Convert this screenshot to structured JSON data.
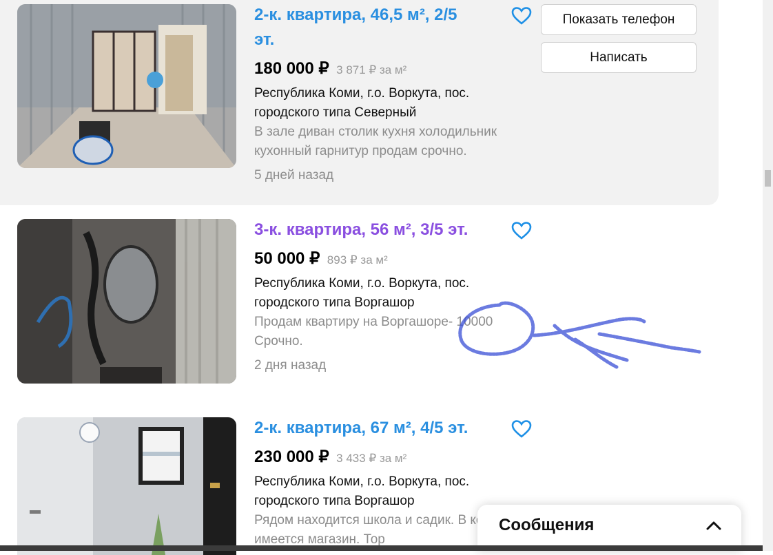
{
  "listings": [
    {
      "title": "2-к. квартира, 46,5 м², 2/5 эт.",
      "price": "180 000 ₽",
      "price_per_m2": "3 871 ₽ за м²",
      "address": "Республика Коми, г.о. Воркута, пос. городского типа Северный",
      "description": "В зале диван столик кухня холодильник кухонный гарнитур продам срочно.",
      "date": "5 дней назад",
      "actions": {
        "phone": "Показать телефон",
        "write": "Написать"
      }
    },
    {
      "title": "3-к. квартира, 56 м², 3/5 эт.",
      "price": "50 000 ₽",
      "price_per_m2": "893 ₽ за м²",
      "address": "Республика Коми, г.о. Воркута, пос. городского типа Воргашор",
      "description": "Продам квартиру на Воргашоре- 10000 Срочно.",
      "date": "2 дня назад"
    },
    {
      "title": "2-к. квартира, 67 м², 4/5 эт.",
      "price": "230 000 ₽",
      "price_per_m2": "3 433 ₽ за м²",
      "address": "Республика Коми, г.о. Воркута, пос. городского типа Воргашор",
      "description": "Рядом находится школа и садик. В конце дома имеется магазин. Тор"
    }
  ],
  "messages_panel": {
    "title": "Сообщения"
  },
  "colors": {
    "link": "#2a8fe0",
    "visited": "#8a4fe0",
    "muted": "#8c8c8c",
    "highlight_bg": "#f2f2f2"
  },
  "icons": [
    "heart-icon",
    "chevron-up-icon"
  ]
}
